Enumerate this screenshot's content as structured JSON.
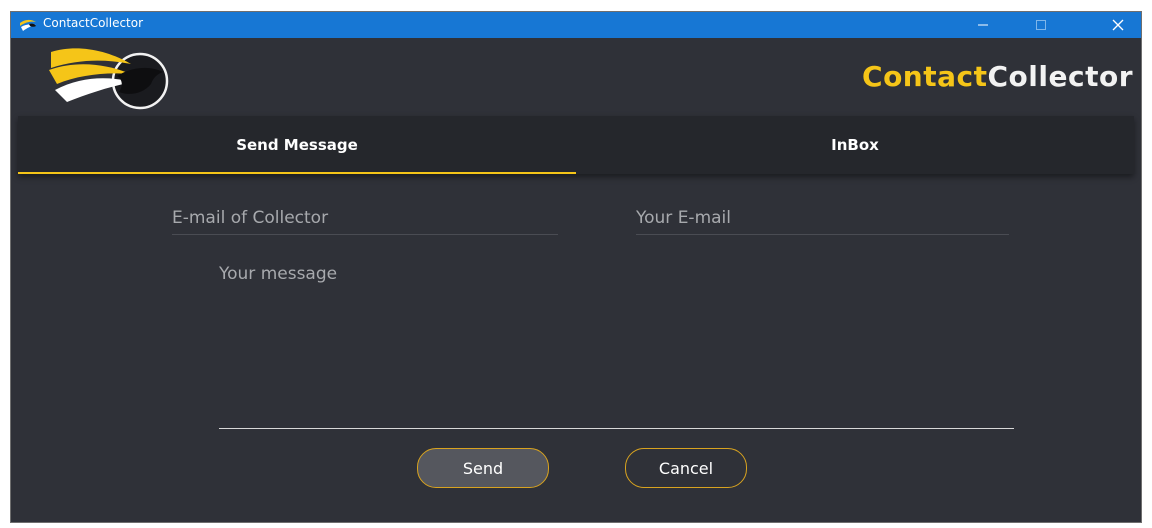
{
  "window": {
    "title": "ContactCollector"
  },
  "header": {
    "brand_part1": "Contact",
    "brand_part2": "Collector",
    "brand_color_accent": "#f5c518"
  },
  "tabs": [
    {
      "label": "Send Message",
      "active": true
    },
    {
      "label": "InBox",
      "active": false
    }
  ],
  "form": {
    "collector_email_placeholder": "E-mail of Collector",
    "your_email_placeholder": "Your E-mail",
    "message_placeholder": "Your message",
    "send_label": "Send",
    "cancel_label": "Cancel"
  },
  "icons": {
    "app": "bird-logo-icon",
    "minimize": "minimize-icon",
    "maximize": "maximize-icon",
    "close": "close-icon"
  }
}
